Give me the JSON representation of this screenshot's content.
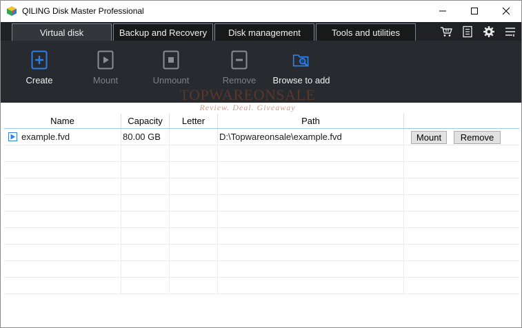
{
  "window": {
    "title": "QILING Disk Master Professional",
    "accent": "#2f7fe8"
  },
  "tabs": [
    {
      "label": "Virtual disk",
      "active": true
    },
    {
      "label": "Backup and Recovery",
      "active": false
    },
    {
      "label": "Disk management",
      "active": false
    },
    {
      "label": "Tools and utilities",
      "active": false
    }
  ],
  "header_icons": [
    "cart-icon",
    "notes-icon",
    "gear-icon",
    "menu-icon"
  ],
  "toolbar": {
    "create": "Create",
    "mount": "Mount",
    "unmount": "Unmount",
    "remove": "Remove",
    "browse": "Browse to add"
  },
  "watermark": {
    "main": "TOPWAREONSALE",
    "sub": "Review. Deal. Giveaway"
  },
  "table": {
    "columns": [
      "Name",
      "Capacity",
      "Letter",
      "Path",
      ""
    ],
    "rows": [
      {
        "name": "example.fvd",
        "capacity": "80.00 GB",
        "letter": "",
        "path": "D:\\Topwareonsale\\example.fvd",
        "mount_label": "Mount",
        "remove_label": "Remove"
      }
    ]
  }
}
